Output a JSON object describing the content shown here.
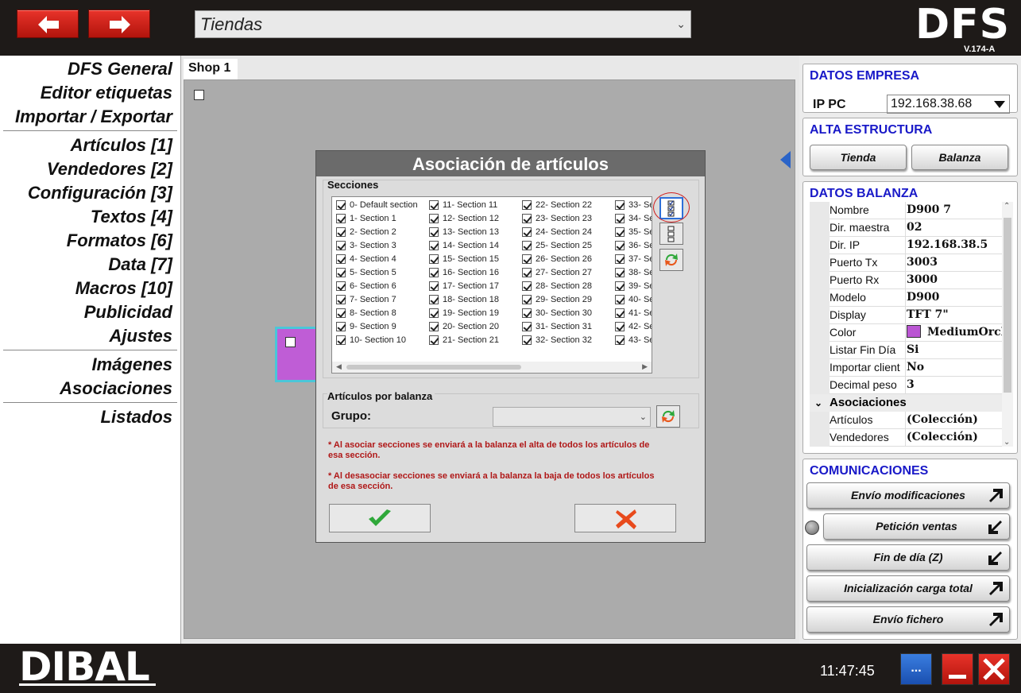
{
  "topbar": {
    "shop_select_value": "Tiendas",
    "logo": "DFS",
    "version": "V.174-A"
  },
  "menu": {
    "group1": [
      "DFS General",
      "Editor etiquetas",
      "Importar / Exportar"
    ],
    "group2": [
      "Artículos [1]",
      "Vendedores [2]",
      "Configuración [3]",
      "Textos [4]",
      "Formatos [6]",
      "Data [7]",
      "Macros [10]",
      "Publicidad",
      "Ajustes"
    ],
    "group3": [
      "Imágenes",
      "Asociaciones"
    ],
    "group4": [
      "Listados"
    ]
  },
  "center": {
    "tab_label": "Shop 1"
  },
  "dialog": {
    "title": "Asociación de artículos",
    "sections_label": "Secciones",
    "sections_col1": [
      "0- Default section",
      "1- Section 1",
      "2- Section 2",
      "3- Section 3",
      "4- Section 4",
      "5- Section 5",
      "6- Section 6",
      "7- Section 7",
      "8- Section 8",
      "9- Section 9",
      "10- Section 10"
    ],
    "sections_col2": [
      "11- Section 11",
      "12- Section 12",
      "13- Section 13",
      "14- Section 14",
      "15- Section 15",
      "16- Section 16",
      "17- Section 17",
      "18- Section 18",
      "19- Section 19",
      "20- Section 20",
      "21- Section 21"
    ],
    "sections_col3": [
      "22- Section 22",
      "23- Section 23",
      "24- Section 24",
      "25- Section 25",
      "26- Section 26",
      "27- Section 27",
      "28- Section 28",
      "29- Section 29",
      "30- Section 30",
      "31- Section 31",
      "32- Section 32"
    ],
    "sections_col4": [
      "33- Se",
      "34- Se",
      "35- Se",
      "36- Se",
      "37- Se",
      "38- Se",
      "39- Se",
      "40- Se",
      "41- Se",
      "42- Se",
      "43- Se"
    ],
    "articles_label": "Artículos por balanza",
    "grupo_label": "Grupo:",
    "note1": "* Al asociar secciones se enviará a la balanza el alta de todos los artículos de esa sección.",
    "note2": "* Al desasociar secciones se enviará a la balanza la baja de todos los artículos de esa sección."
  },
  "datos_empresa": {
    "title": "DATOS EMPRESA",
    "ip_label": "IP PC",
    "ip_value": "192.168.38.68"
  },
  "alta_estructura": {
    "title": "ALTA ESTRUCTURA",
    "tienda": "Tienda",
    "balanza": "Balanza"
  },
  "datos_balanza": {
    "title": "DATOS BALANZA",
    "props": [
      {
        "name": "Nombre",
        "value": "D900 7"
      },
      {
        "name": "Dir. maestra",
        "value": "02"
      },
      {
        "name": "Dir. IP",
        "value": "192.168.38.5"
      },
      {
        "name": "Puerto Tx",
        "value": "3003"
      },
      {
        "name": "Puerto Rx",
        "value": "3000"
      },
      {
        "name": "Modelo",
        "value": "D900"
      },
      {
        "name": "Display",
        "value": "TFT 7\""
      },
      {
        "name": "Color",
        "value": "MediumOrcl"
      },
      {
        "name": "Listar Fin Día",
        "value": "Si"
      },
      {
        "name": "Importar client",
        "value": "No"
      },
      {
        "name": "Decimal peso",
        "value": "3"
      }
    ],
    "category": "Asociaciones",
    "assoc": [
      {
        "name": "Artículos",
        "value": "(Colección)"
      },
      {
        "name": "Vendedores",
        "value": "(Colección)"
      }
    ],
    "color_swatch": "#ba55d3"
  },
  "comunicaciones": {
    "title": "COMUNICACIONES",
    "buttons": [
      "Envío modificaciones",
      "Petición ventas",
      "Fin de día (Z)",
      "Inicialización carga total",
      "Envío fichero"
    ]
  },
  "bottombar": {
    "logo": "DIBAL",
    "clock": "11:47:45",
    "more_label": "..."
  }
}
